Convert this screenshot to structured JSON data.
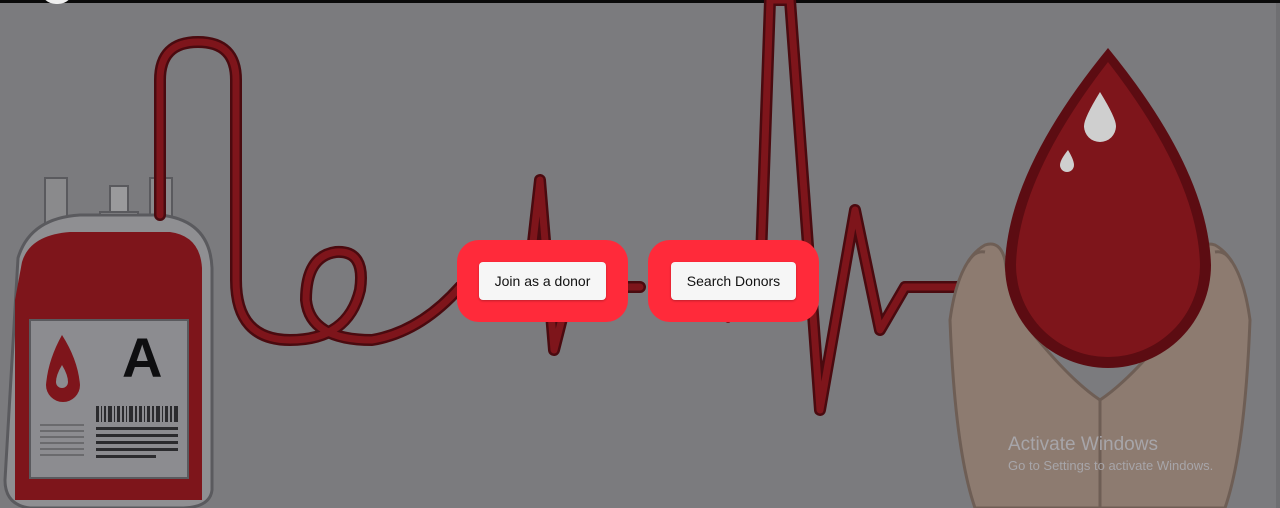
{
  "buttons": {
    "join_label": "Join as a donor",
    "search_label": "Search Donors"
  },
  "blood_bag": {
    "group_letter": "A"
  },
  "watermark": {
    "title": "Activate Windows",
    "subtitle": "Go to Settings to activate Windows."
  },
  "colors": {
    "background": "#7b7b7e",
    "accent": "#ff2a3a",
    "blood": "#7e151b"
  }
}
